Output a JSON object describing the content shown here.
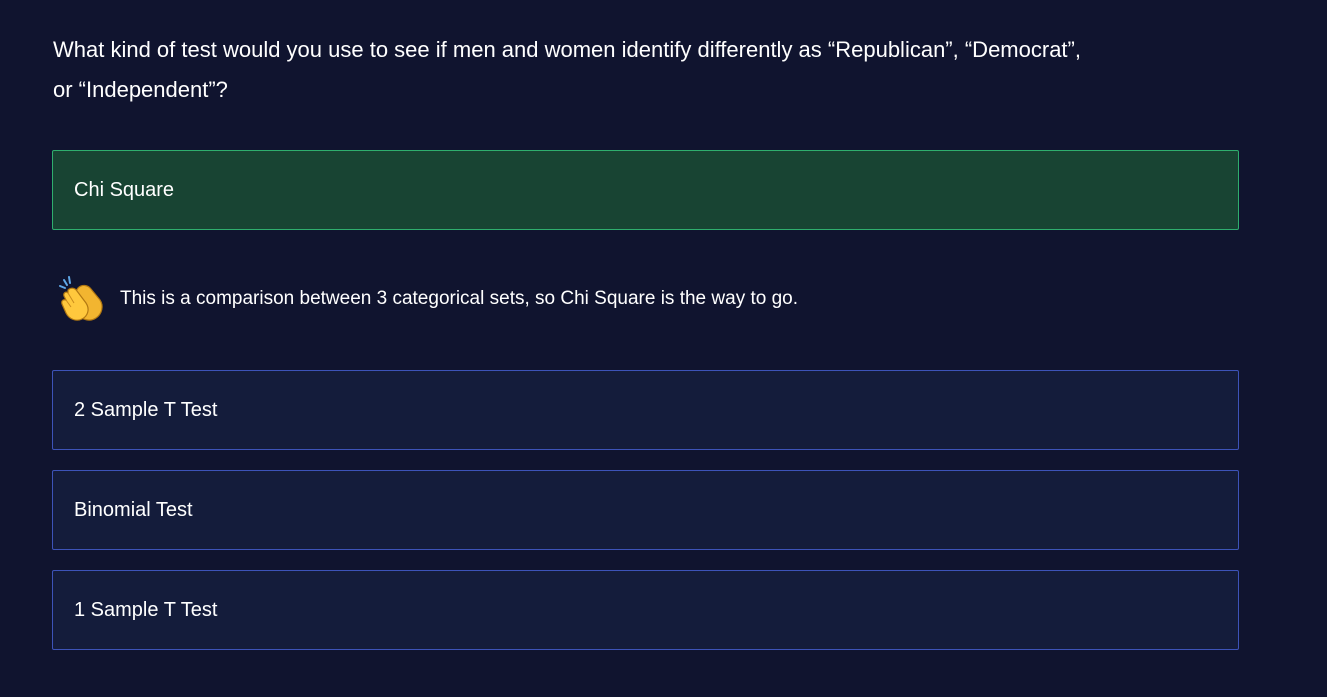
{
  "question": {
    "line1": "What kind of test would you use to see if men and women identify differently as “Republican”, “Democrat”,",
    "line2": "or “Independent”?"
  },
  "options": [
    {
      "label": "Chi Square",
      "state": "correct"
    },
    {
      "label": "2 Sample T Test",
      "state": "default"
    },
    {
      "label": "Binomial Test",
      "state": "default"
    },
    {
      "label": "1 Sample T Test",
      "state": "default"
    }
  ],
  "feedback": {
    "icon": "clapping-hands-icon",
    "text": "This is a comparison between 3 categorical sets, so Chi Square is the way to go."
  },
  "colors": {
    "background": "#10142f",
    "option_bg": "#141c3b",
    "option_border": "#3d53b8",
    "correct_bg": "#184433",
    "correct_border": "#2fae6e"
  }
}
